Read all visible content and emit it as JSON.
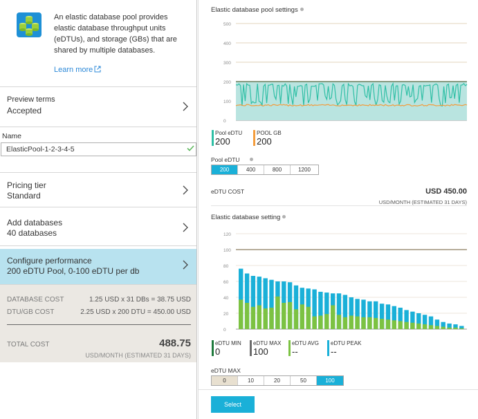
{
  "intro": {
    "description": "An elastic database pool provides elastic database throughput units (eDTUs), and storage (GBs) that are shared by multiple databases.",
    "learn_more": "Learn more"
  },
  "preview": {
    "label": "Preview terms",
    "value": "Accepted"
  },
  "name": {
    "label": "Name",
    "value": "ElasticPool-1-2-3-4-5"
  },
  "pricing": {
    "label": "Pricing tier",
    "value": "Standard"
  },
  "add_databases": {
    "label": "Add databases",
    "value": "40 databases"
  },
  "configure": {
    "label": "Configure performance",
    "value": "200 eDTU Pool, 0-100 eDTU per db"
  },
  "cost": {
    "database_cost_label": "DATABASE COST",
    "database_cost_value": "1.25 USD x 31 DBs = 38.75 USD",
    "dtu_gb_cost_label": "DTU/GB COST",
    "dtu_gb_cost_value": "2.25 USD x 200 DTU = 450.00 USD",
    "total_label": "TOTAL COST",
    "total_value": "488.75",
    "total_sub": "USD/MONTH (ESTIMATED 31 DAYS)"
  },
  "pool_settings": {
    "title": "Elastic database pool settings",
    "metrics": [
      {
        "label": "Pool eDTU",
        "value": "200",
        "color": "#2ebfa5"
      },
      {
        "label": "POOL GB",
        "value": "200",
        "color": "#f39c3c"
      }
    ],
    "selector_label": "Pool eDTU",
    "options": [
      "200",
      "400",
      "800",
      "1200"
    ],
    "selected": "200",
    "cost_label": "eDTU COST",
    "cost_value": "USD 450.00",
    "cost_sub": "USD/MONTH (ESTIMATED 31 DAYS)"
  },
  "db_settings": {
    "title": "Elastic database setting",
    "metrics": [
      {
        "label": "eDTU MIN",
        "value": "0",
        "color": "#1e7a3c"
      },
      {
        "label": "eDTU MAX",
        "value": "100",
        "color": "#6b6b6b"
      },
      {
        "label": "eDTU AVG",
        "value": "--",
        "color": "#7cc242"
      },
      {
        "label": "eDTU PEAK",
        "value": "--",
        "color": "#1ab0d8"
      }
    ],
    "selector_label": "eDTU MAX",
    "options": [
      "0",
      "10",
      "20",
      "50",
      "100"
    ],
    "selected": "100"
  },
  "select_button": "Select",
  "chart_data": [
    {
      "type": "line",
      "yticks": [
        0,
        100,
        200,
        300,
        400,
        500
      ],
      "ylim": [
        0,
        500
      ],
      "series": [
        {
          "name": "Pool eDTU",
          "color": "#2ebfa5",
          "style": "fluctuating line between ~60 and ~190"
        },
        {
          "name": "POOL GB",
          "color": "#f39c3c",
          "style": "near-flat line around ~75"
        }
      ],
      "reference_line": 200,
      "shaded_band": [
        0,
        200
      ]
    },
    {
      "type": "bar",
      "yticks": [
        0,
        20,
        40,
        60,
        80,
        100,
        120
      ],
      "ylim": [
        0,
        120
      ],
      "reference_line": 100,
      "series": [
        {
          "name": "eDTU PEAK",
          "color": "#1ab0d8",
          "values": [
            76,
            70,
            67,
            66,
            64,
            62,
            60,
            60,
            59,
            55,
            52,
            51,
            50,
            47,
            46,
            45,
            45,
            43,
            40,
            38,
            37,
            35,
            35,
            32,
            31,
            29,
            27,
            24,
            22,
            20,
            18,
            16,
            12,
            9,
            7,
            6,
            4
          ]
        },
        {
          "name": "eDTU AVG",
          "color": "#7cc242",
          "values": [
            37,
            33,
            28,
            30,
            26,
            27,
            41,
            33,
            34,
            25,
            31,
            28,
            16,
            17,
            19,
            30,
            18,
            15,
            17,
            16,
            15,
            15,
            14,
            13,
            12,
            11,
            10,
            9,
            8,
            7,
            6,
            5,
            4,
            3,
            2,
            2,
            1
          ]
        }
      ],
      "x_count": 37
    }
  ]
}
